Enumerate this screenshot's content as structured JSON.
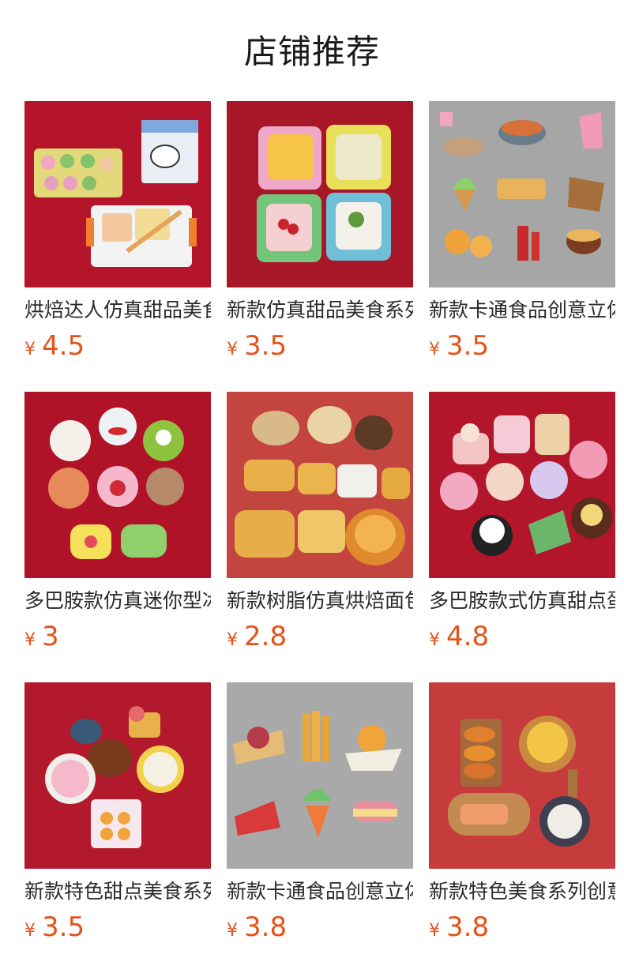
{
  "header": {
    "title": "店铺推荐"
  },
  "colors": {
    "price": "#e4531b",
    "bg_red": "#b5152b",
    "bg_gray": "#a8a8a8",
    "bg_coral": "#c9403e"
  },
  "products": [
    {
      "name": "烘焙达人仿真甜品美食",
      "currency": "¥",
      "price": "4.5",
      "image": "bakery-set-photo",
      "bg": "#b5152b"
    },
    {
      "name": "新款仿真甜品美食系列",
      "currency": "¥",
      "price": "3.5",
      "image": "dessert-bowls-photo",
      "bg": "#a81728"
    },
    {
      "name": "新款卡通食品创意立体",
      "currency": "¥",
      "price": "3.5",
      "image": "cartoon-food-magnets-photo",
      "bg": "#a6a6a6"
    },
    {
      "name": "多巴胺款仿真迷你型冰",
      "currency": "¥",
      "price": "3",
      "image": "cartoon-cakes-photo",
      "bg": "#b01327"
    },
    {
      "name": "新款树脂仿真烘焙面包",
      "currency": "¥",
      "price": "2.8",
      "image": "bread-basket-photo",
      "bg": "#c44540"
    },
    {
      "name": "多巴胺款式仿真甜点蛋",
      "currency": "¥",
      "price": "4.8",
      "image": "mini-cakes-photo",
      "bg": "#b3162a"
    },
    {
      "name": "新款特色甜点美食系列",
      "currency": "¥",
      "price": "3.5",
      "image": "tea-set-photo",
      "bg": "#b3192c"
    },
    {
      "name": "新款卡通食品创意立体",
      "currency": "¥",
      "price": "3.8",
      "image": "snack-magnets-photo",
      "bg": "#a9a9a9"
    },
    {
      "name": "新款特色美食系列创意",
      "currency": "¥",
      "price": "3.8",
      "image": "food-boards-photo",
      "bg": "#c63b3c"
    }
  ]
}
